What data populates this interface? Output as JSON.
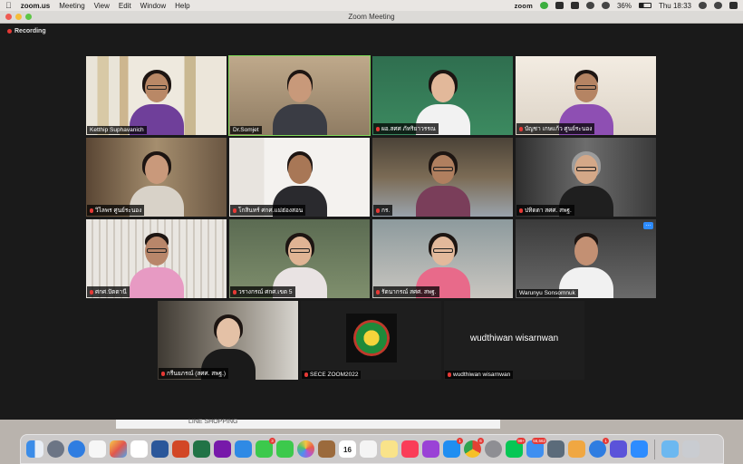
{
  "menubar": {
    "app_name": "zoom.us",
    "menus": [
      "Meeting",
      "View",
      "Edit",
      "Window",
      "Help"
    ],
    "status_zoom": "zoom",
    "battery": "36%",
    "clock": "Thu 18:33"
  },
  "window": {
    "title": "Zoom Meeting",
    "recording_label": "Recording"
  },
  "participants": [
    {
      "name": "Ketthip Suphavanich",
      "muted": false
    },
    {
      "name": "Dr.Somjet",
      "muted": false,
      "active": true
    },
    {
      "name": "ผอ.สศศ ภัทริยาวรรณ",
      "muted": true
    },
    {
      "name": "บัญชา เกษแก้ว ศูนย์ระนอง",
      "muted": true
    },
    {
      "name": "วิไลพร ศูนย์ระนอง",
      "muted": true
    },
    {
      "name": "โกสินทร์ ศกศ.แม่ฮ่องสอน",
      "muted": true
    },
    {
      "name": "กร.",
      "muted": true
    },
    {
      "name": "ปทิดตา สศศ. สพฐ.",
      "muted": true
    },
    {
      "name": "ศกศ.ปัตตานี",
      "muted": true
    },
    {
      "name": "วรางกรณ์ ศกศ.เขต 5",
      "muted": true
    },
    {
      "name": "รัตนากรณ์ สศศ. สพฐ.",
      "muted": true
    },
    {
      "name": "Warunyu Sonsomnuk",
      "muted": false
    },
    {
      "name": "กรีนยภรณ์ (สศศ. สพฐ.)",
      "muted": true
    },
    {
      "name": "SECE ZOOM2022",
      "muted": true
    },
    {
      "name": "wudthiwan wisarnwan",
      "muted": true,
      "display_name": "wudthiwan wisarnwan"
    }
  ],
  "behind_window": {
    "text": "LINE SHOPPING"
  },
  "dock": {
    "calendar_day": "16",
    "badges": {
      "facetime": "3",
      "appstore": "1",
      "chrome": "6",
      "line": "99+",
      "mail": "56,662",
      "safari2": "1"
    }
  },
  "colors": {
    "active_speaker": "#7ed957",
    "muted_mic": "#e53935",
    "accent": "#2d8cff"
  }
}
